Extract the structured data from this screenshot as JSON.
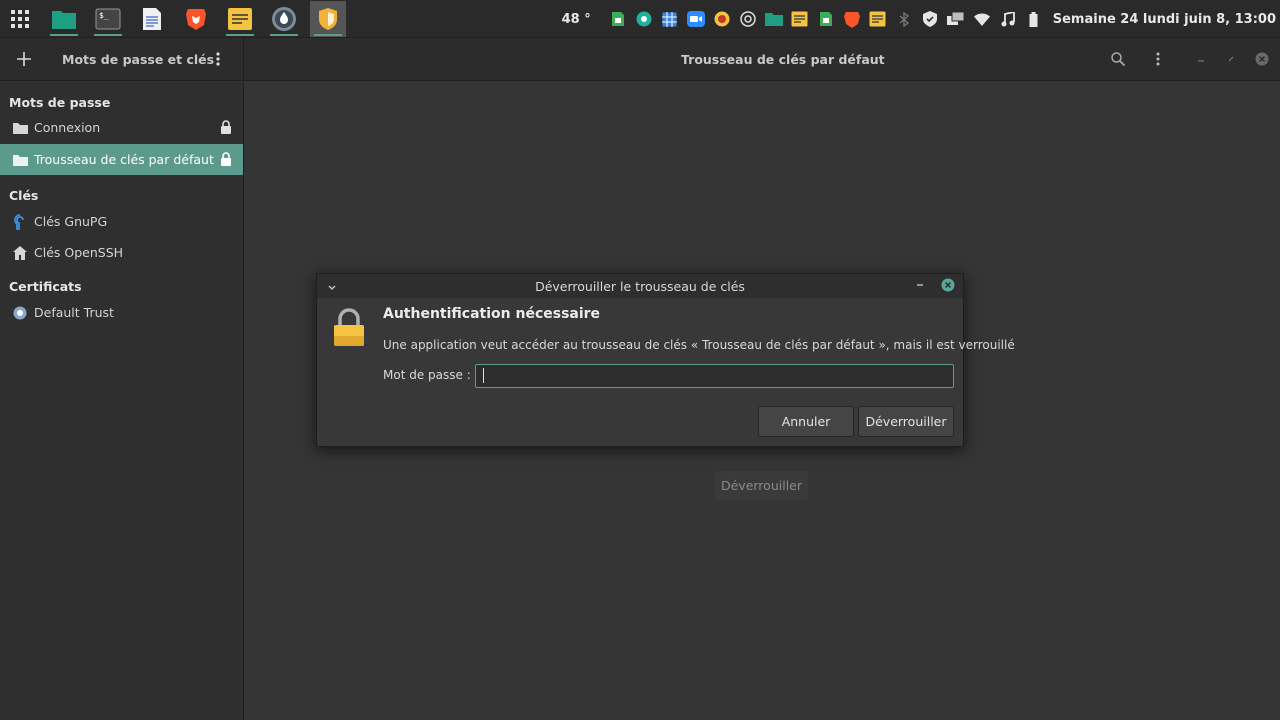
{
  "panel": {
    "temperature": "48 °",
    "clock": "Semaine 24 lundi juin  8, 13:00"
  },
  "window": {
    "sidebar_title": "Mots de passe et clés",
    "title": "Trousseau de clés par défaut"
  },
  "sidebar": {
    "sections": [
      {
        "label": "Mots de passe"
      },
      {
        "label": "Clés"
      },
      {
        "label": "Certificats"
      }
    ],
    "items": [
      {
        "label": "Connexion",
        "icon": "folder-icon",
        "locked": true
      },
      {
        "label": "Trousseau de clés par défaut",
        "icon": "folder-icon",
        "locked": true,
        "selected": true
      },
      {
        "label": "Clés GnuPG",
        "icon": "gnupg-key-icon"
      },
      {
        "label": "Clés OpenSSH",
        "icon": "home-icon"
      },
      {
        "label": "Default Trust",
        "icon": "certificate-icon"
      }
    ]
  },
  "main": {
    "unlock_label": "Déverrouiller"
  },
  "dialog": {
    "title": "Déverrouiller le trousseau de clés",
    "heading": "Authentification nécessaire",
    "message": "Une application veut accéder au trousseau de clés « Trousseau de clés par défaut », mais il est verrouillé",
    "password_label": "Mot de passe :",
    "password_value": "",
    "cancel_label": "Annuler",
    "unlock_label": "Déverrouiller"
  },
  "colors": {
    "accent": "#5c9a8e",
    "background": "#353535",
    "lock_yellow": "#f5c242"
  }
}
